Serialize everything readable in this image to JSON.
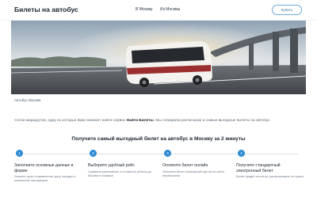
{
  "header": {
    "logo": "Билеты на автобус",
    "nav": [
      "В Москву",
      "Из Москвы"
    ],
    "cta_label": "Купить"
  },
  "hero": {
    "image_caption": "Автобус Москва"
  },
  "description": {
    "before": "Сотни маршрутов, одну из которых Вам поможет найти сервис ",
    "brand": "Найти Билеты",
    "after": ". Мы собираем расписание и самые выгодные билеты на автобус."
  },
  "section_heading": "Получите самый выгодный билет на автобус в Москву за 2 минуты",
  "steps": [
    {
      "num": "1",
      "title": "Заполните основные данные в форме",
      "desc": "Укажите пункт отправления, дату поездки и количество пассажиров"
    },
    {
      "num": "2",
      "title": "Выберите удобный рейс",
      "desc": "Сравните расписание и стоимость рейсов до Москвы в сервисе"
    },
    {
      "num": "3",
      "title": "Оплатите билет онлайн",
      "desc": "Оплатите билет банковской картой на сайте перевозчика"
    },
    {
      "num": "4",
      "title": "Получите стандартный электронный билет",
      "desc": "Билет придёт на почту, распечатывать не нужно"
    }
  ],
  "colors": {
    "accent": "#2d8bd3",
    "border": "#6aa9d8",
    "text": "#1c2530"
  }
}
